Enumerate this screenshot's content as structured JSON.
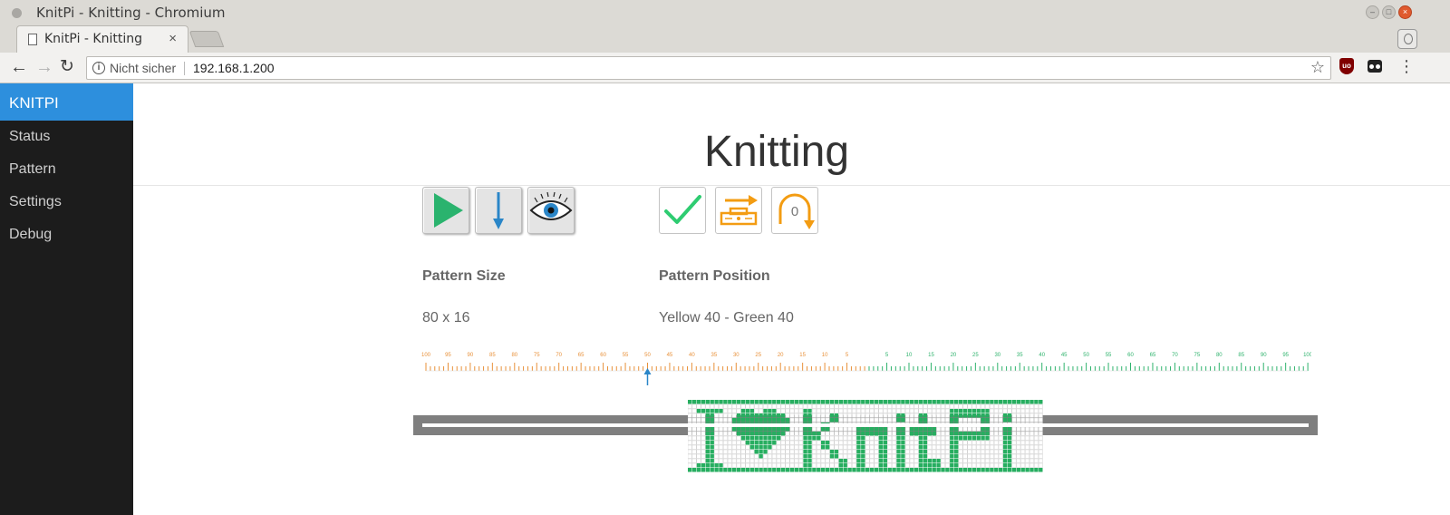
{
  "window": {
    "title": "KnitPi - Knitting - Chromium"
  },
  "tab": {
    "title": "KnitPi - Knitting",
    "close_glyph": "×"
  },
  "toolbar": {
    "security_label": "Nicht sicher",
    "url": "192.168.1.200"
  },
  "sidebar": {
    "brand": "KNITPI",
    "items": [
      {
        "label": "Status"
      },
      {
        "label": "Pattern"
      },
      {
        "label": "Settings"
      },
      {
        "label": "Debug"
      }
    ]
  },
  "main": {
    "title": "Knitting",
    "controls_left": [
      {
        "icon": "play-icon",
        "color": "#2ab36e"
      },
      {
        "icon": "arrow-down-icon",
        "color": "#2a86c8"
      },
      {
        "icon": "eye-icon",
        "color": "#2a86c8"
      }
    ],
    "controls_right": [
      {
        "icon": "checkmark-icon",
        "color": "#2ecc71"
      },
      {
        "icon": "carriage-direction-icon",
        "color": "#f39c12"
      },
      {
        "icon": "row-counter-icon",
        "color": "#f39c12",
        "count": "0"
      }
    ],
    "pattern_size": {
      "label": "Pattern Size",
      "value": "80 x 16"
    },
    "pattern_position": {
      "label": "Pattern Position",
      "value": "Yellow 40 - Green 40"
    }
  },
  "needle_ruler": {
    "left_color": "#e8913a",
    "right_color": "#2fb36d",
    "left_labels": [
      "100",
      "95",
      "90",
      "85",
      "80",
      "75",
      "70",
      "65",
      "60",
      "55",
      "50",
      "45",
      "40",
      "35",
      "30",
      "25",
      "20",
      "15",
      "10",
      "5"
    ],
    "right_labels": [
      "5",
      "10",
      "15",
      "20",
      "25",
      "30",
      "35",
      "40",
      "45",
      "50",
      "55",
      "60",
      "65",
      "70",
      "75",
      "80",
      "85",
      "90",
      "95",
      "100"
    ],
    "marker_label": "50",
    "marker_color": "#2a86c8"
  },
  "pattern_preview": {
    "text": "I ♥ KnitPi",
    "ink_color": "#27ae60",
    "grid_color": "#c9c9c9",
    "columns": 80,
    "rows": 16
  }
}
